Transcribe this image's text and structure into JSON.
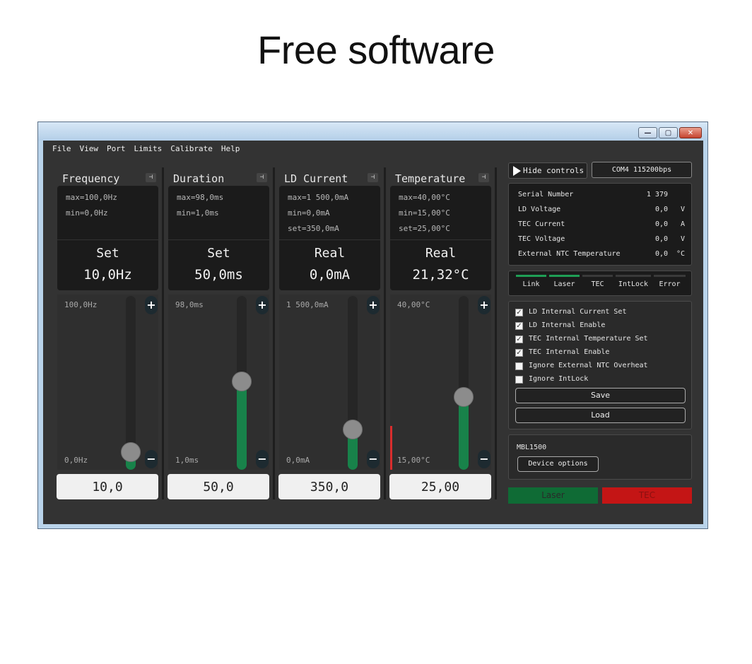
{
  "heading": "Free software",
  "window_buttons": {
    "minimize": "—",
    "maximize": "▢",
    "close": "✕"
  },
  "menu": [
    "File",
    "View",
    "Port",
    "Limits",
    "Calibrate",
    "Help"
  ],
  "pin_glyph": "⊣",
  "columns": [
    {
      "title": "Frequency",
      "max": "max=100,0Hz",
      "min": "min=0,0Hz",
      "set": "",
      "mode": "Set",
      "display": "10,0Hz",
      "scale_max": "100,0Hz",
      "scale_min": "0,0Hz",
      "input": "10,0",
      "slider_fraction": 0.1,
      "indicator_fraction": 0
    },
    {
      "title": "Duration",
      "max": "max=98,0ms",
      "min": "min=1,0ms",
      "set": "",
      "mode": "Set",
      "display": "50,0ms",
      "scale_max": "98,0ms",
      "scale_min": "1,0ms",
      "input": "50,0",
      "slider_fraction": 0.51,
      "indicator_fraction": 0
    },
    {
      "title": "LD Current",
      "max": "max=1 500,0mA",
      "min": "min=0,0mA",
      "set": "set=350,0mA",
      "mode": "Real",
      "display": "0,0mA",
      "scale_max": "1 500,0mA",
      "scale_min": "0,0mA",
      "input": "350,0",
      "slider_fraction": 0.23,
      "indicator_fraction": 0
    },
    {
      "title": "Temperature",
      "max": "max=40,00°C",
      "min": "min=15,00°C",
      "set": "set=25,00°C",
      "mode": "Real",
      "display": "21,32°C",
      "scale_max": "40,00°C",
      "scale_min": "15,00°C",
      "input": "25,00",
      "slider_fraction": 0.42,
      "indicator_fraction": 0.25
    }
  ],
  "step": {
    "plus": "+",
    "minus": "−"
  },
  "right": {
    "hide_controls": "Hide controls",
    "port": "COM4   115200bps",
    "device_info": [
      {
        "label": "Serial Number",
        "value": "1 379",
        "unit": ""
      },
      {
        "label": "LD Voltage",
        "value": "0,0",
        "unit": "V"
      },
      {
        "label": "TEC Current",
        "value": "0,0",
        "unit": "A"
      },
      {
        "label": "TEC Voltage",
        "value": "0,0",
        "unit": "V"
      },
      {
        "label": "External NTC Temperature",
        "value": "0,0",
        "unit": "°C"
      }
    ],
    "status": [
      {
        "label": "Link",
        "active": true
      },
      {
        "label": "Laser",
        "active": true
      },
      {
        "label": "TEC",
        "active": false
      },
      {
        "label": "IntLock",
        "active": false
      },
      {
        "label": "Error",
        "active": false
      }
    ],
    "options": [
      {
        "label": "LD Internal Current Set",
        "checked": true
      },
      {
        "label": "LD Internal Enable",
        "checked": true
      },
      {
        "label": "TEC Internal Temperature Set",
        "checked": true
      },
      {
        "label": "TEC Internal Enable",
        "checked": true
      },
      {
        "label": "Ignore External NTC Overheat",
        "checked": false
      },
      {
        "label": "Ignore IntLock",
        "checked": false
      }
    ],
    "save": "Save",
    "load": "Load",
    "model": "MBL1500",
    "device_options": "Device options",
    "laser": "Laser",
    "tec": "TEC",
    "colors": {
      "laser_button": "#0f6b35",
      "tec_button": "#c41515",
      "slider_fill": "#18824a",
      "status_on": "#1f9e55"
    }
  }
}
